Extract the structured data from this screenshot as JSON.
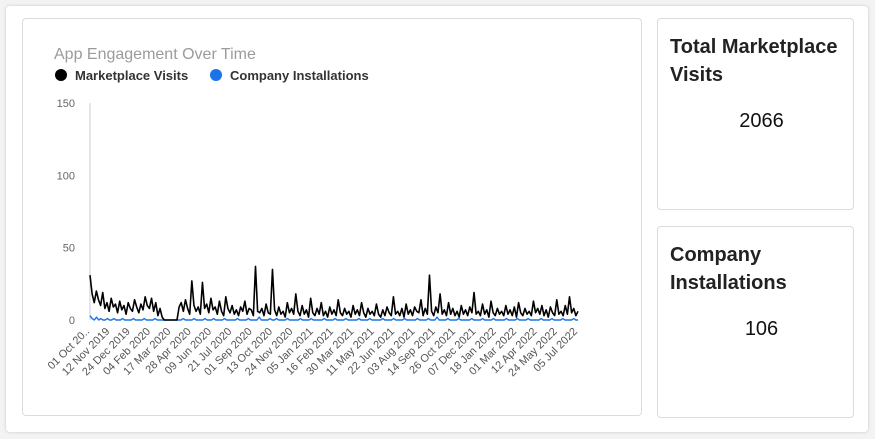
{
  "chart_card": {
    "title": "App Engagement Over Time",
    "legend": [
      {
        "label": "Marketplace Visits",
        "color": "#000000"
      },
      {
        "label": "Company Installations",
        "color": "#1a73e8"
      }
    ]
  },
  "stats": {
    "visits": {
      "title": "Total Marketplace Visits",
      "value": "2066"
    },
    "installs": {
      "title": "Company Installations",
      "value": "106"
    }
  },
  "chart_data": {
    "type": "line",
    "title": "App Engagement Over Time",
    "xlabel": "",
    "ylabel": "",
    "ylim": [
      0,
      150
    ],
    "y_ticks": [
      0,
      50,
      100,
      150
    ],
    "grid": false,
    "legend_position": "top-left",
    "x_tick_labels": [
      "01 Oct 20..",
      "12 Nov 2019",
      "24 Dec 2019",
      "04 Feb 2020",
      "17 Mar 2020",
      "28 Apr 2020",
      "09 Jun 2020",
      "21 Jul 2020",
      "01 Sep 2020",
      "13 Oct 2020",
      "24 Nov 2020",
      "05 Jan 2021",
      "16 Feb 2021",
      "30 Mar 2021",
      "11 May 2021",
      "22 Jun 2021",
      "03 Aug 2021",
      "14 Sep 2021",
      "26 Oct 2021",
      "07 Dec 2021",
      "18 Jan 2022",
      "01 Mar 2022",
      "12 Apr 2022",
      "24 May 2022",
      "05 Jul 2022"
    ],
    "series": [
      {
        "name": "Marketplace Visits",
        "color": "#000000",
        "values": [
          31,
          18,
          12,
          20,
          14,
          10,
          19,
          8,
          12,
          6,
          15,
          9,
          11,
          5,
          13,
          7,
          10,
          4,
          12,
          8,
          6,
          14,
          9,
          5,
          11,
          7,
          16,
          10,
          8,
          15,
          6,
          12,
          3,
          8,
          2,
          0,
          0,
          0,
          0,
          0,
          0,
          0,
          9,
          12,
          6,
          14,
          8,
          4,
          27,
          10,
          6,
          9,
          4,
          26,
          8,
          11,
          5,
          15,
          7,
          9,
          4,
          13,
          6,
          3,
          16,
          8,
          5,
          10,
          4,
          7,
          3,
          9,
          6,
          13,
          4,
          8,
          7,
          3,
          37,
          6,
          5,
          8,
          3,
          11,
          5,
          4,
          35,
          7,
          3,
          9,
          4,
          6,
          2,
          12,
          5,
          8,
          4,
          18,
          6,
          3,
          10,
          4,
          7,
          2,
          15,
          5,
          3,
          8,
          4,
          12,
          3,
          6,
          2,
          9,
          4,
          7,
          3,
          14,
          5,
          3,
          8,
          4,
          6,
          2,
          10,
          4,
          7,
          3,
          12,
          5,
          2,
          8,
          4,
          6,
          3,
          11,
          4,
          2,
          7,
          3,
          9,
          5,
          3,
          16,
          4,
          6,
          3,
          8,
          2,
          11,
          4,
          7,
          3,
          9,
          6,
          5,
          14,
          3,
          8,
          4,
          31,
          6,
          3,
          9,
          5,
          18,
          4,
          7,
          3,
          12,
          4,
          8,
          3,
          6,
          2,
          10,
          4,
          7,
          3,
          9,
          5,
          19,
          4,
          6,
          3,
          11,
          4,
          7,
          2,
          13,
          5,
          3,
          8,
          4,
          6,
          3,
          10,
          4,
          7,
          3,
          9,
          2,
          12,
          5,
          3,
          8,
          4,
          6,
          3,
          13,
          5,
          8,
          4,
          10,
          3,
          7,
          2,
          9,
          5,
          3,
          14,
          4,
          6,
          3,
          10,
          4,
          16,
          5,
          8,
          3,
          6
        ],
        "__note_values": "approximate reading of the dense daily series"
      },
      {
        "name": "Company Installations",
        "color": "#1a73e8",
        "values": [
          3,
          1,
          0,
          2,
          0,
          1,
          0,
          0,
          1,
          0,
          0,
          1,
          0,
          0,
          0,
          1,
          0,
          0,
          0,
          0,
          1,
          0,
          0,
          0,
          0,
          1,
          0,
          0,
          0,
          0,
          1,
          0,
          0,
          0,
          0,
          0,
          0,
          0,
          0,
          0,
          0,
          0,
          0,
          1,
          0,
          0,
          0,
          0,
          1,
          0,
          0,
          0,
          0,
          1,
          0,
          0,
          0,
          1,
          0,
          0,
          0,
          0,
          1,
          0,
          0,
          0,
          0,
          0,
          1,
          0,
          0,
          0,
          0,
          1,
          0,
          0,
          0,
          0,
          2,
          0,
          0,
          0,
          0,
          1,
          0,
          0,
          1,
          0,
          0,
          0,
          0,
          1,
          0,
          0,
          0,
          0,
          0,
          1,
          0,
          0,
          0,
          0,
          1,
          0,
          0,
          0,
          0,
          0,
          1,
          0,
          0,
          0,
          0,
          1,
          0,
          0,
          0,
          0,
          1,
          0,
          0,
          0,
          0,
          0,
          1,
          0,
          0,
          0,
          0,
          1,
          0,
          0,
          0,
          0,
          0,
          1,
          0,
          0,
          0,
          0,
          1,
          0,
          0,
          0,
          0,
          1,
          0,
          0,
          0,
          0,
          0,
          1,
          0,
          0,
          0,
          0,
          1,
          0,
          0,
          0,
          2,
          0,
          0,
          0,
          0,
          1,
          0,
          0,
          0,
          0,
          1,
          0,
          0,
          0,
          0,
          0,
          1,
          0,
          0,
          0,
          0,
          1,
          0,
          0,
          0,
          0,
          1,
          0,
          0,
          0,
          0,
          0,
          1,
          0,
          0,
          0,
          0,
          1,
          0,
          0,
          0,
          0,
          1,
          0,
          0,
          0,
          0,
          0,
          1,
          0,
          0,
          0,
          0,
          1,
          0,
          0,
          0,
          0,
          1,
          0,
          0,
          0,
          0,
          1,
          0,
          0
        ]
      }
    ]
  }
}
